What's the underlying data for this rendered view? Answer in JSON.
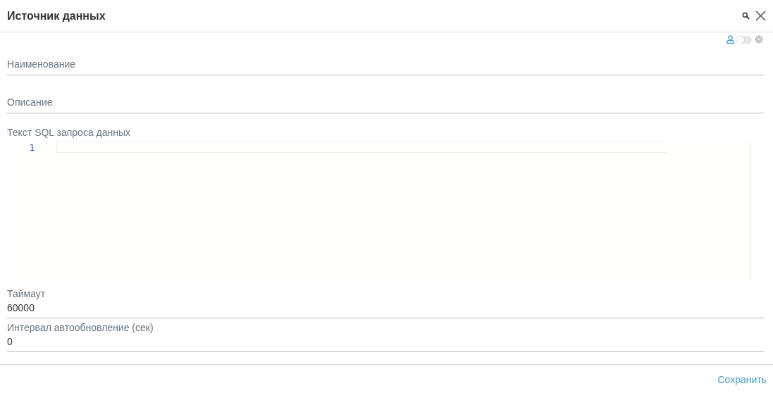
{
  "window": {
    "title": "Источник данных"
  },
  "toolbar": {
    "toggle": {
      "on": false
    }
  },
  "fields": [
    {
      "kind": "text",
      "placeholder": "Наименование"
    },
    {
      "kind": "text",
      "placeholder": "Описание"
    },
    {
      "kind": "code",
      "label": "Текст SQL запроса данных",
      "line_numbers": [
        "1"
      ]
    },
    {
      "kind": "labeled",
      "label": "Таймаут",
      "value": "60000"
    },
    {
      "kind": "labeled",
      "label": "Интервал автообновление (сек)",
      "value": "0"
    }
  ],
  "footer": {
    "buttons": [
      "Сохранить"
    ]
  }
}
